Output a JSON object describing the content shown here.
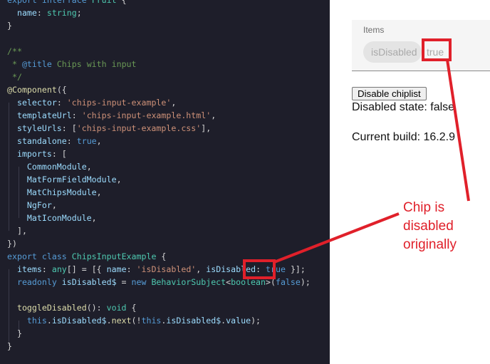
{
  "code": {
    "lines": [
      [
        [
          "export ",
          "kw"
        ],
        [
          "interface ",
          "kw"
        ],
        [
          "Fruit ",
          "ty"
        ],
        [
          "{",
          "pn"
        ]
      ],
      [
        [
          "  name",
          "prop"
        ],
        [
          ": ",
          "pn"
        ],
        [
          "string",
          "ty"
        ],
        [
          ";",
          "pn"
        ]
      ],
      [
        [
          "}",
          "pn"
        ]
      ],
      [],
      [
        [
          "/**",
          "cmt"
        ]
      ],
      [
        [
          " * ",
          "cmt"
        ],
        [
          "@title",
          "kw"
        ],
        [
          " Chips with input",
          "cmt"
        ]
      ],
      [
        [
          " */",
          "cmt"
        ]
      ],
      [
        [
          "@",
          "dec"
        ],
        [
          "Component",
          "fn"
        ],
        [
          "({",
          "pn"
        ]
      ],
      [
        [
          "  selector",
          "prop"
        ],
        [
          ": ",
          "pn"
        ],
        [
          "'chips-input-example'",
          "str"
        ],
        [
          ",",
          "pn"
        ]
      ],
      [
        [
          "  templateUrl",
          "prop"
        ],
        [
          ": ",
          "pn"
        ],
        [
          "'chips-input-example.html'",
          "str"
        ],
        [
          ",",
          "pn"
        ]
      ],
      [
        [
          "  styleUrls",
          "prop"
        ],
        [
          ": [",
          "pn"
        ],
        [
          "'chips-input-example.css'",
          "str"
        ],
        [
          "],",
          "pn"
        ]
      ],
      [
        [
          "  standalone",
          "prop"
        ],
        [
          ": ",
          "pn"
        ],
        [
          "true",
          "kw"
        ],
        [
          ",",
          "pn"
        ]
      ],
      [
        [
          "  imports",
          "prop"
        ],
        [
          ": [",
          "pn"
        ]
      ],
      [
        [
          "    CommonModule",
          "prop"
        ],
        [
          ",",
          "pn"
        ]
      ],
      [
        [
          "    MatFormFieldModule",
          "prop"
        ],
        [
          ",",
          "pn"
        ]
      ],
      [
        [
          "    MatChipsModule",
          "prop"
        ],
        [
          ",",
          "pn"
        ]
      ],
      [
        [
          "    NgFor",
          "prop"
        ],
        [
          ",",
          "pn"
        ]
      ],
      [
        [
          "    MatIconModule",
          "prop"
        ],
        [
          ",",
          "pn"
        ]
      ],
      [
        [
          "  ],",
          "pn"
        ]
      ],
      [
        [
          "})",
          "pn"
        ]
      ],
      [
        [
          "export ",
          "kw"
        ],
        [
          "class ",
          "kw"
        ],
        [
          "ChipsInputExample ",
          "ty"
        ],
        [
          "{",
          "pn"
        ]
      ],
      [
        [
          "  items",
          "prop"
        ],
        [
          ": ",
          "pn"
        ],
        [
          "any",
          "ty"
        ],
        [
          "[] = [{ ",
          "pn"
        ],
        [
          "name",
          "prop"
        ],
        [
          ": ",
          "pn"
        ],
        [
          "'isDisabled'",
          "str"
        ],
        [
          ", ",
          "pn"
        ],
        [
          "isDisabled",
          "prop"
        ],
        [
          ": ",
          "pn"
        ],
        [
          "true",
          "kw"
        ],
        [
          " }];",
          "pn"
        ]
      ],
      [
        [
          "  readonly ",
          "kw"
        ],
        [
          "isDisabled$",
          "prop"
        ],
        [
          " = ",
          "pn"
        ],
        [
          "new ",
          "kw"
        ],
        [
          "BehaviorSubject",
          "ty"
        ],
        [
          "<",
          "pn"
        ],
        [
          "boolean",
          "ty"
        ],
        [
          ">(",
          "pn"
        ],
        [
          "false",
          "kw"
        ],
        [
          ");",
          "pn"
        ]
      ],
      [],
      [
        [
          "  toggleDisabled",
          "fn"
        ],
        [
          "(): ",
          "pn"
        ],
        [
          "void ",
          "ty"
        ],
        [
          "{",
          "pn"
        ]
      ],
      [
        [
          "    this",
          "kw"
        ],
        [
          ".",
          "pn"
        ],
        [
          "isDisabled$",
          "prop"
        ],
        [
          ".",
          "pn"
        ],
        [
          "next",
          "fn"
        ],
        [
          "(!",
          "pn"
        ],
        [
          "this",
          "kw"
        ],
        [
          ".",
          "pn"
        ],
        [
          "isDisabled$",
          "prop"
        ],
        [
          ".",
          "pn"
        ],
        [
          "value",
          "prop"
        ],
        [
          ");",
          "pn"
        ]
      ],
      [
        [
          "  }",
          "pn"
        ]
      ],
      [
        [
          "}",
          "pn"
        ]
      ]
    ]
  },
  "preview": {
    "field_label": "Items",
    "chip_label": "isDisabled",
    "input_value": "true",
    "button_label": "Disable chiplist",
    "disabled_state": "Disabled state: false",
    "current_build": "Current build: 16.2.9"
  },
  "annotation": {
    "text": "Chip is disabled originally",
    "color": "#e0202a"
  }
}
